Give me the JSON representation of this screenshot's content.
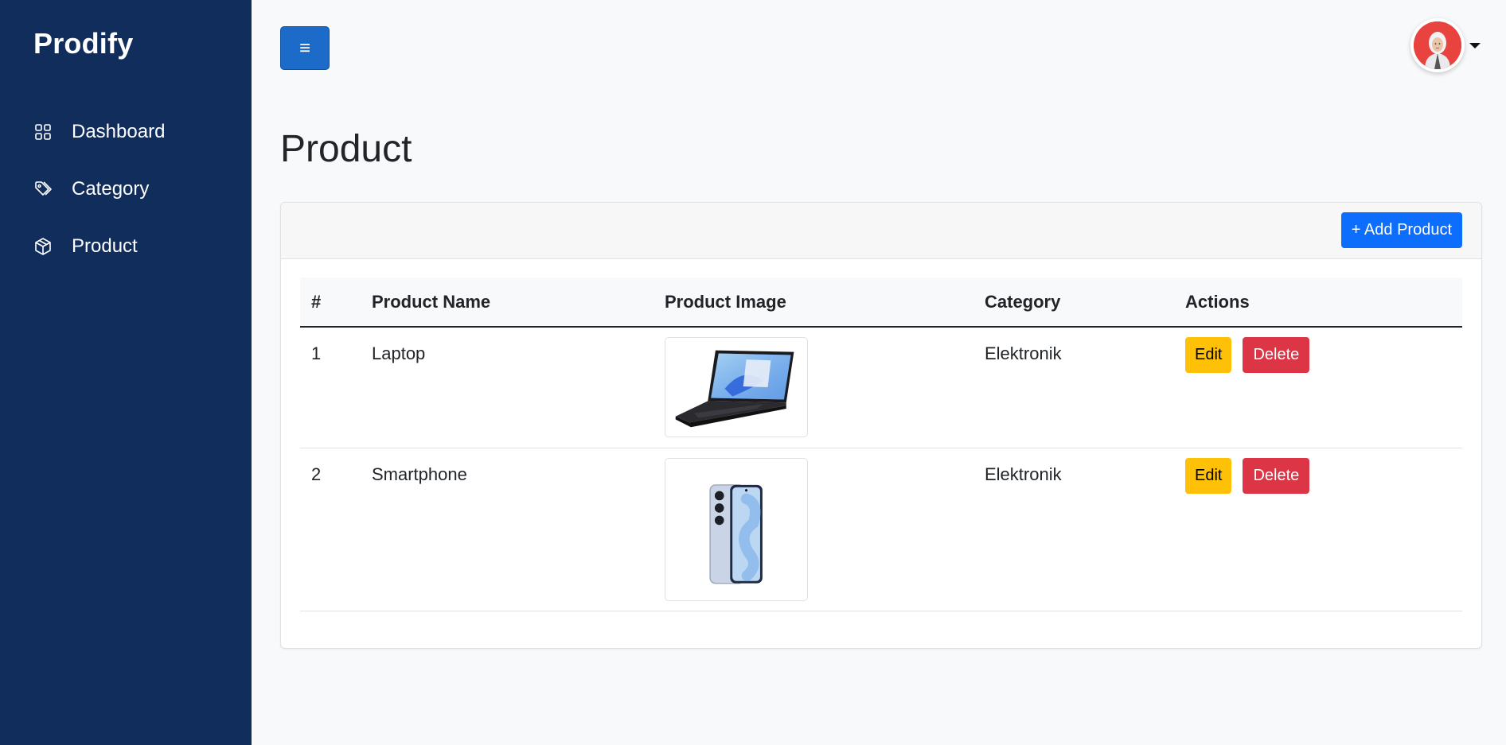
{
  "sidebar": {
    "brand": "Prodify",
    "items": [
      {
        "label": "Dashboard",
        "icon": "grid-icon"
      },
      {
        "label": "Category",
        "icon": "tags-icon"
      },
      {
        "label": "Product",
        "icon": "box-icon"
      }
    ]
  },
  "topbar": {
    "toggle_label": "≡",
    "avatar": "user-avatar"
  },
  "page": {
    "title": "Product"
  },
  "card": {
    "add_button": "+ Add Product"
  },
  "table": {
    "columns": [
      "#",
      "Product Name",
      "Product Image",
      "Category",
      "Actions"
    ],
    "rows": [
      {
        "no": "1",
        "name": "Laptop",
        "image": "laptop-image",
        "category": "Elektronik",
        "edit": "Edit",
        "delete": "Delete"
      },
      {
        "no": "2",
        "name": "Smartphone",
        "image": "smartphone-image",
        "category": "Elektronik",
        "edit": "Edit",
        "delete": "Delete"
      }
    ]
  },
  "colors": {
    "sidebar": "#102d5c",
    "primary": "#0d6efd",
    "warning": "#ffc107",
    "danger": "#dc3545"
  }
}
